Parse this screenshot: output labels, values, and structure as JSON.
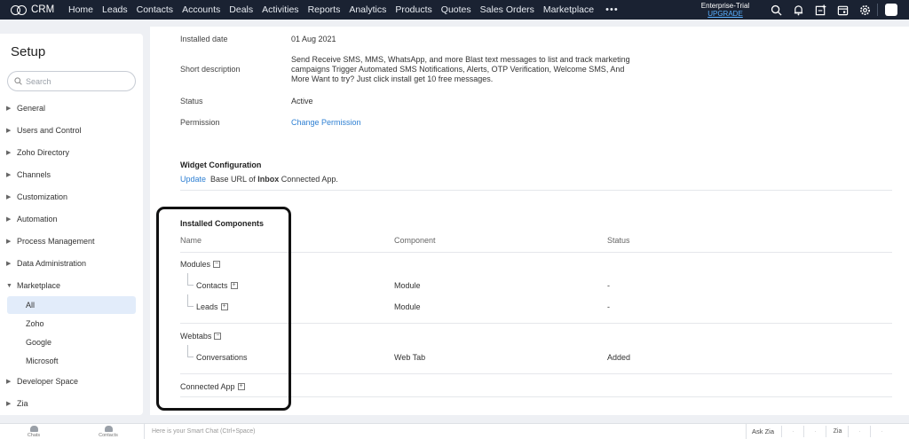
{
  "topbar": {
    "brand": "CRM",
    "nav": [
      "Home",
      "Leads",
      "Contacts",
      "Accounts",
      "Deals",
      "Activities",
      "Reports",
      "Analytics",
      "Products",
      "Quotes",
      "Sales Orders",
      "Marketplace"
    ],
    "more": "•••",
    "edition": "Enterprise-Trial",
    "upgrade": "UPGRADE",
    "icons": [
      "search-icon",
      "bell-icon",
      "add-entry-icon",
      "calendar-icon",
      "gear-icon"
    ]
  },
  "sidebar": {
    "title": "Setup",
    "search_placeholder": "Search",
    "items": [
      {
        "label": "General"
      },
      {
        "label": "Users and Control"
      },
      {
        "label": "Zoho Directory"
      },
      {
        "label": "Channels"
      },
      {
        "label": "Customization"
      },
      {
        "label": "Automation"
      },
      {
        "label": "Process Management"
      },
      {
        "label": "Data Administration"
      },
      {
        "label": "Marketplace"
      },
      {
        "label": "Developer Space"
      },
      {
        "label": "Zia"
      }
    ],
    "marketplace_sub": [
      {
        "label": "All",
        "active": true
      },
      {
        "label": "Zoho"
      },
      {
        "label": "Google"
      },
      {
        "label": "Microsoft"
      }
    ]
  },
  "details": {
    "installed_date_label": "Installed date",
    "installed_date_value": "01 Aug 2021",
    "short_desc_label": "Short description",
    "short_desc_value": "Send Receive SMS, MMS, WhatsApp, and more Blast text messages to list and track marketing campaigns Trigger Automated SMS Notifications, Alerts, OTP Verification, Welcome SMS, And More Want to try? Just click install get 10 free messages.",
    "status_label": "Status",
    "status_value": "Active",
    "permission_label": "Permission",
    "permission_value": "Change Permission"
  },
  "widget": {
    "title": "Widget Configuration",
    "update_link": "Update",
    "text_before": "Base URL of",
    "text_bold": "Inbox",
    "text_after": "Connected App."
  },
  "components": {
    "title": "Installed Components",
    "headers": {
      "name": "Name",
      "component": "Component",
      "status": "Status"
    },
    "groups": {
      "modules": "Modules",
      "webtabs": "Webtabs",
      "connected_app": "Connected App"
    },
    "rows": [
      {
        "name": "Contacts",
        "component": "Module",
        "status": "-"
      },
      {
        "name": "Leads",
        "component": "Module",
        "status": "-"
      },
      {
        "name": "Conversations",
        "component": "Web Tab",
        "status": "Added"
      }
    ]
  },
  "bottombar": {
    "chats": "Chats",
    "contacts": "Contacts",
    "smart_chat": "Here is your Smart Chat (Ctrl+Space)",
    "ask_zia": "Ask Zia",
    "zia_icon_text": "Zia"
  }
}
